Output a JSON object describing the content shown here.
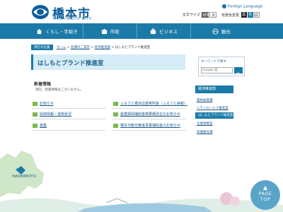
{
  "header": {
    "logo_ja": "橋本市",
    "logo_en": "HASHIMOTO CITY",
    "foreign_language": "Foreign Language",
    "text_size_label": "文字サイズ",
    "text_size_options": [
      "標準",
      "大"
    ],
    "bg_color_label": "背景色変更",
    "bg_color_options": [
      "黒",
      "青",
      "白"
    ]
  },
  "nav": {
    "items": [
      {
        "label": "くらし・手続き",
        "icon": "house-icon"
      },
      {
        "label": "市政",
        "icon": "city-hall-icon"
      },
      {
        "label": "ビジネス",
        "icon": "business-icon"
      },
      {
        "label": "観光",
        "icon": "sightseeing-icon"
      }
    ]
  },
  "breadcrumb": {
    "here_label": "現在の位置",
    "items": [
      "ホーム",
      "各課のご案内",
      "経済推進部"
    ],
    "current": "はしもとブランド推進室"
  },
  "page": {
    "title": "はしもとブランド推進室",
    "news_heading": "新着情報",
    "news_text": "現在、新着情報はございません。"
  },
  "links": {
    "left": [
      "お知らせ",
      "採用情報・運用状況",
      "募集"
    ],
    "right": [
      "ふるさと橋本応援寄附金（ふるさと納税）",
      "産業振興補助金等要綱改正のお知らせ",
      "橋本市観光推進事業補助金のお知らせ"
    ]
  },
  "sidebar": {
    "keyword_heading": "キーワードで探す",
    "search_placeholder": "Google 拡",
    "section_heading": "経済推進部",
    "items": [
      "農林振興課",
      "シティセールス推進室",
      "はしもとブランド推進室",
      "企業誘致室",
      "商業観光課"
    ],
    "active_index": 2
  },
  "illustration": {
    "map_label": "HASHIMOTO"
  },
  "page_top": {
    "line1": "PAGE",
    "line2": "TOP"
  },
  "colors": {
    "primary": "#1b7aa8",
    "title_bg": "#d6ecf6",
    "link": "#1a5a8a",
    "folder": "#7cb94f",
    "map_green": "#cfe6c8"
  }
}
